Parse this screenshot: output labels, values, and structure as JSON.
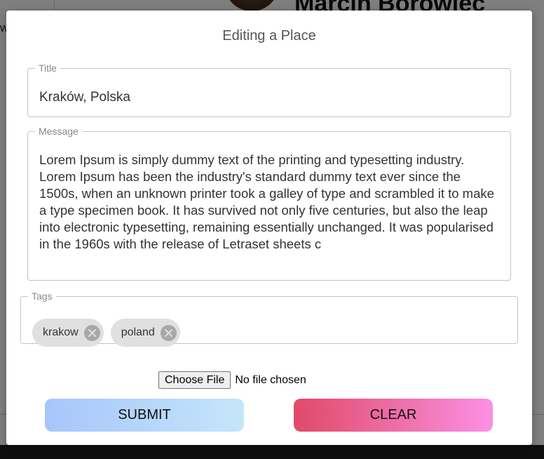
{
  "background": {
    "profile_name": "Marcin Borowiec",
    "left_text": "w"
  },
  "modal": {
    "title": "Editing a Place",
    "fields": {
      "title": {
        "label": "Title",
        "value": "Kraków, Polska"
      },
      "message": {
        "label": "Message",
        "value": "Lorem Ipsum is simply dummy text of the printing and typesetting industry. Lorem Ipsum has been the industry's standard dummy text ever since the 1500s, when an unknown printer took a galley of type and scrambled it to make a type specimen book. It has survived not only five centuries, but also the leap into electronic typesetting, remaining essentially unchanged. It was popularised in the 1960s with the release of Letraset sheets c"
      },
      "tags": {
        "label": "Tags",
        "chips": [
          {
            "label": "krakow",
            "icon": "close-circle-icon"
          },
          {
            "label": "poland",
            "icon": "close-circle-icon"
          }
        ]
      }
    },
    "file_input": {
      "button_label": "Choose File",
      "status": "No file chosen"
    },
    "buttons": {
      "submit": "SUBMIT",
      "clear": "CLEAR"
    }
  },
  "colors": {
    "submit_gradient": [
      "#a6c6fb",
      "#c5e6fa"
    ],
    "clear_gradient": [
      "#e04a68",
      "#fb90e4"
    ],
    "overlay": "rgba(0,0,0,0.5)"
  }
}
